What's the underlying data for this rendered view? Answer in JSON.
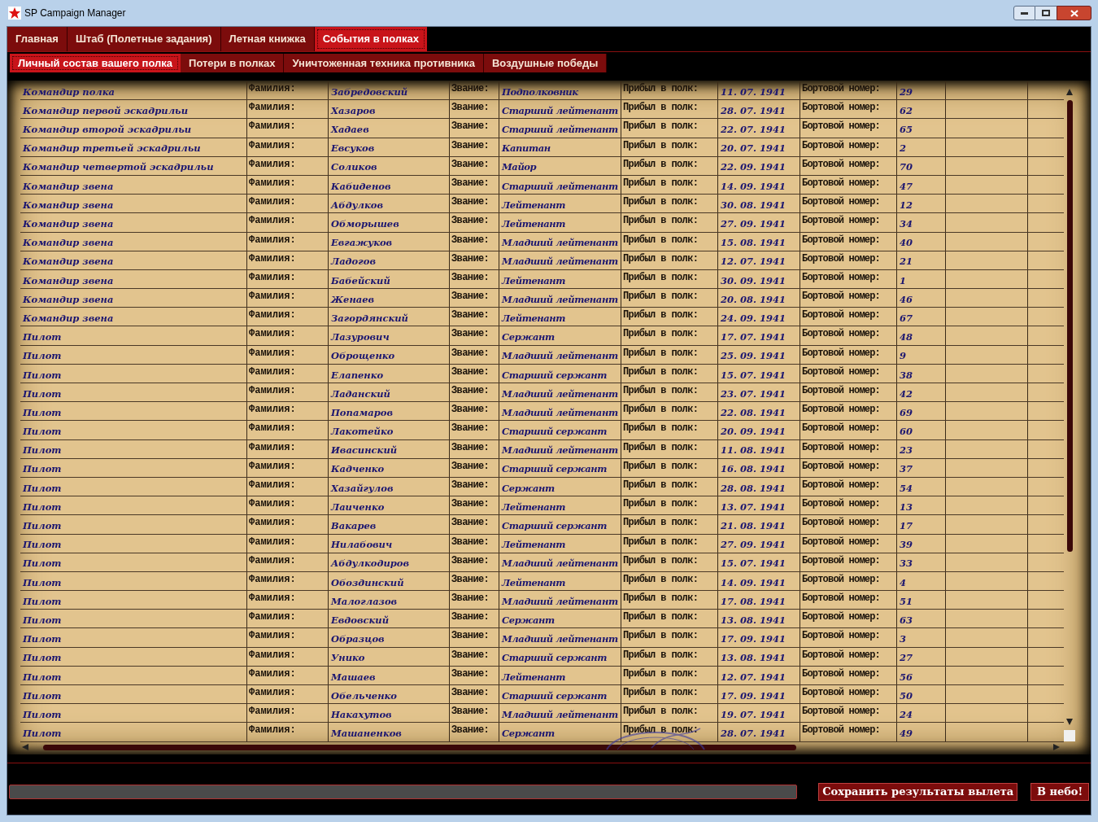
{
  "window": {
    "title": "SP Campaign Manager"
  },
  "tabs": [
    {
      "label": "Главная",
      "selected": false
    },
    {
      "label": "Штаб (Полетные задания)",
      "selected": false
    },
    {
      "label": "Летная книжка",
      "selected": false
    },
    {
      "label": "События в полках",
      "selected": true
    }
  ],
  "subtabs": [
    {
      "label": "Личный состав вашего полка",
      "selected": true
    },
    {
      "label": "Потери в полках",
      "selected": false
    },
    {
      "label": "Уничтоженная техника противника",
      "selected": false
    },
    {
      "label": "Воздушные победы",
      "selected": false
    }
  ],
  "rows": [
    {
      "role": "Командир полка",
      "surname_label": "Фамилия:",
      "surname": "Забредовский",
      "rank_label": "Звание:",
      "rank": "Подполковник",
      "arrived_label": "Прибыл в полк:",
      "arrived": "11. 07. 1941",
      "number_label": "Бортовой номер:",
      "number": "29"
    },
    {
      "role": "Командир первой эскадрильи",
      "surname_label": "Фамилия:",
      "surname": "Хазаров",
      "rank_label": "Звание:",
      "rank": "Старший лейтенант",
      "arrived_label": "Прибыл в полк:",
      "arrived": "28. 07. 1941",
      "number_label": "Бортовой номер:",
      "number": "62"
    },
    {
      "role": "Командир второй эскадрильи",
      "surname_label": "Фамилия:",
      "surname": "Хадаев",
      "rank_label": "Звание:",
      "rank": "Старший лейтенант",
      "arrived_label": "Прибыл в полк:",
      "arrived": "22. 07. 1941",
      "number_label": "Бортовой номер:",
      "number": "65"
    },
    {
      "role": "Командир третьей эскадрильи",
      "surname_label": "Фамилия:",
      "surname": "Евсуков",
      "rank_label": "Звание:",
      "rank": "Капитан",
      "arrived_label": "Прибыл в полк:",
      "arrived": "20. 07. 1941",
      "number_label": "Бортовой номер:",
      "number": "2"
    },
    {
      "role": "Командир четвертой эскадрильи",
      "surname_label": "Фамилия:",
      "surname": "Соликов",
      "rank_label": "Звание:",
      "rank": "Майор",
      "arrived_label": "Прибыл в полк:",
      "arrived": "22. 09. 1941",
      "number_label": "Бортовой номер:",
      "number": "70"
    },
    {
      "role": "Командир звена",
      "surname_label": "Фамилия:",
      "surname": "Кабиденов",
      "rank_label": "Звание:",
      "rank": "Старший лейтенант",
      "arrived_label": "Прибыл в полк:",
      "arrived": "14. 09. 1941",
      "number_label": "Бортовой номер:",
      "number": "47"
    },
    {
      "role": "Командир звена",
      "surname_label": "Фамилия:",
      "surname": "Абдулков",
      "rank_label": "Звание:",
      "rank": "Лейтенант",
      "arrived_label": "Прибыл в полк:",
      "arrived": "30. 08. 1941",
      "number_label": "Бортовой номер:",
      "number": "12"
    },
    {
      "role": "Командир звена",
      "surname_label": "Фамилия:",
      "surname": "Обморышев",
      "rank_label": "Звание:",
      "rank": "Лейтенант",
      "arrived_label": "Прибыл в полк:",
      "arrived": "27. 09. 1941",
      "number_label": "Бортовой номер:",
      "number": "34"
    },
    {
      "role": "Командир звена",
      "surname_label": "Фамилия:",
      "surname": "Евгажуков",
      "rank_label": "Звание:",
      "rank": "Младший лейтенант",
      "arrived_label": "Прибыл в полк:",
      "arrived": "15. 08. 1941",
      "number_label": "Бортовой номер:",
      "number": "40"
    },
    {
      "role": "Командир звена",
      "surname_label": "Фамилия:",
      "surname": "Ладогов",
      "rank_label": "Звание:",
      "rank": "Младший лейтенант",
      "arrived_label": "Прибыл в полк:",
      "arrived": "12. 07. 1941",
      "number_label": "Бортовой номер:",
      "number": "21"
    },
    {
      "role": "Командир звена",
      "surname_label": "Фамилия:",
      "surname": "Бабейский",
      "rank_label": "Звание:",
      "rank": "Лейтенант",
      "arrived_label": "Прибыл в полк:",
      "arrived": "30. 09. 1941",
      "number_label": "Бортовой номер:",
      "number": "1"
    },
    {
      "role": "Командир звена",
      "surname_label": "Фамилия:",
      "surname": "Женаев",
      "rank_label": "Звание:",
      "rank": "Младший лейтенант",
      "arrived_label": "Прибыл в полк:",
      "arrived": "20. 08. 1941",
      "number_label": "Бортовой номер:",
      "number": "46"
    },
    {
      "role": "Командир звена",
      "surname_label": "Фамилия:",
      "surname": "Загордянский",
      "rank_label": "Звание:",
      "rank": "Лейтенант",
      "arrived_label": "Прибыл в полк:",
      "arrived": "24. 09. 1941",
      "number_label": "Бортовой номер:",
      "number": "67"
    },
    {
      "role": "Пилот",
      "surname_label": "Фамилия:",
      "surname": "Лазурович",
      "rank_label": "Звание:",
      "rank": "Сержант",
      "arrived_label": "Прибыл в полк:",
      "arrived": "17. 07. 1941",
      "number_label": "Бортовой номер:",
      "number": "48"
    },
    {
      "role": "Пилот",
      "surname_label": "Фамилия:",
      "surname": "Оброщенко",
      "rank_label": "Звание:",
      "rank": "Младший лейтенант",
      "arrived_label": "Прибыл в полк:",
      "arrived": "25. 09. 1941",
      "number_label": "Бортовой номер:",
      "number": "9"
    },
    {
      "role": "Пилот",
      "surname_label": "Фамилия:",
      "surname": "Елапенко",
      "rank_label": "Звание:",
      "rank": "Старший сержант",
      "arrived_label": "Прибыл в полк:",
      "arrived": "15. 07. 1941",
      "number_label": "Бортовой номер:",
      "number": "38"
    },
    {
      "role": "Пилот",
      "surname_label": "Фамилия:",
      "surname": "Ладанский",
      "rank_label": "Звание:",
      "rank": "Младший лейтенант",
      "arrived_label": "Прибыл в полк:",
      "arrived": "23. 07. 1941",
      "number_label": "Бортовой номер:",
      "number": "42"
    },
    {
      "role": "Пилот",
      "surname_label": "Фамилия:",
      "surname": "Попамаров",
      "rank_label": "Звание:",
      "rank": "Младший лейтенант",
      "arrived_label": "Прибыл в полк:",
      "arrived": "22. 08. 1941",
      "number_label": "Бортовой номер:",
      "number": "69"
    },
    {
      "role": "Пилот",
      "surname_label": "Фамилия:",
      "surname": "Лакотейко",
      "rank_label": "Звание:",
      "rank": "Старший сержант",
      "arrived_label": "Прибыл в полк:",
      "arrived": "20. 09. 1941",
      "number_label": "Бортовой номер:",
      "number": "60"
    },
    {
      "role": "Пилот",
      "surname_label": "Фамилия:",
      "surname": "Ивасинский",
      "rank_label": "Звание:",
      "rank": "Младший лейтенант",
      "arrived_label": "Прибыл в полк:",
      "arrived": "11. 08. 1941",
      "number_label": "Бортовой номер:",
      "number": "23"
    },
    {
      "role": "Пилот",
      "surname_label": "Фамилия:",
      "surname": "Кадченко",
      "rank_label": "Звание:",
      "rank": "Старший сержант",
      "arrived_label": "Прибыл в полк:",
      "arrived": "16. 08. 1941",
      "number_label": "Бортовой номер:",
      "number": "37"
    },
    {
      "role": "Пилот",
      "surname_label": "Фамилия:",
      "surname": "Хазайгулов",
      "rank_label": "Звание:",
      "rank": "Сержант",
      "arrived_label": "Прибыл в полк:",
      "arrived": "28. 08. 1941",
      "number_label": "Бортовой номер:",
      "number": "54"
    },
    {
      "role": "Пилот",
      "surname_label": "Фамилия:",
      "surname": "Лаиченко",
      "rank_label": "Звание:",
      "rank": "Лейтенант",
      "arrived_label": "Прибыл в полк:",
      "arrived": "13. 07. 1941",
      "number_label": "Бортовой номер:",
      "number": "13"
    },
    {
      "role": "Пилот",
      "surname_label": "Фамилия:",
      "surname": "Вакарев",
      "rank_label": "Звание:",
      "rank": "Старший сержант",
      "arrived_label": "Прибыл в полк:",
      "arrived": "21. 08. 1941",
      "number_label": "Бортовой номер:",
      "number": "17"
    },
    {
      "role": "Пилот",
      "surname_label": "Фамилия:",
      "surname": "Нилабович",
      "rank_label": "Звание:",
      "rank": "Лейтенант",
      "arrived_label": "Прибыл в полк:",
      "arrived": "27. 09. 1941",
      "number_label": "Бортовой номер:",
      "number": "39"
    },
    {
      "role": "Пилот",
      "surname_label": "Фамилия:",
      "surname": "Абдулкодиров",
      "rank_label": "Звание:",
      "rank": "Младший лейтенант",
      "arrived_label": "Прибыл в полк:",
      "arrived": "15. 07. 1941",
      "number_label": "Бортовой номер:",
      "number": "33"
    },
    {
      "role": "Пилот",
      "surname_label": "Фамилия:",
      "surname": "Обоздинский",
      "rank_label": "Звание:",
      "rank": "Лейтенант",
      "arrived_label": "Прибыл в полк:",
      "arrived": "14. 09. 1941",
      "number_label": "Бортовой номер:",
      "number": "4"
    },
    {
      "role": "Пилот",
      "surname_label": "Фамилия:",
      "surname": "Малоглазов",
      "rank_label": "Звание:",
      "rank": "Младший лейтенант",
      "arrived_label": "Прибыл в полк:",
      "arrived": "17. 08. 1941",
      "number_label": "Бортовой номер:",
      "number": "51"
    },
    {
      "role": "Пилот",
      "surname_label": "Фамилия:",
      "surname": "Евдовский",
      "rank_label": "Звание:",
      "rank": "Сержант",
      "arrived_label": "Прибыл в полк:",
      "arrived": "13. 08. 1941",
      "number_label": "Бортовой номер:",
      "number": "63"
    },
    {
      "role": "Пилот",
      "surname_label": "Фамилия:",
      "surname": "Образцов",
      "rank_label": "Звание:",
      "rank": "Младший лейтенант",
      "arrived_label": "Прибыл в полк:",
      "arrived": "17. 09. 1941",
      "number_label": "Бортовой номер:",
      "number": "3"
    },
    {
      "role": "Пилот",
      "surname_label": "Фамилия:",
      "surname": "Унико",
      "rank_label": "Звание:",
      "rank": "Старший сержант",
      "arrived_label": "Прибыл в полк:",
      "arrived": "13. 08. 1941",
      "number_label": "Бортовой номер:",
      "number": "27"
    },
    {
      "role": "Пилот",
      "surname_label": "Фамилия:",
      "surname": "Машаев",
      "rank_label": "Звание:",
      "rank": "Лейтенант",
      "arrived_label": "Прибыл в полк:",
      "arrived": "12. 07. 1941",
      "number_label": "Бортовой номер:",
      "number": "56"
    },
    {
      "role": "Пилот",
      "surname_label": "Фамилия:",
      "surname": "Обельченко",
      "rank_label": "Звание:",
      "rank": "Старший сержант",
      "arrived_label": "Прибыл в полк:",
      "arrived": "17. 09. 1941",
      "number_label": "Бортовой номер:",
      "number": "50"
    },
    {
      "role": "Пилот",
      "surname_label": "Фамилия:",
      "surname": "Накахутов",
      "rank_label": "Звание:",
      "rank": "Младший лейтенант",
      "arrived_label": "Прибыл в полк:",
      "arrived": "19. 07. 1941",
      "number_label": "Бортовой номер:",
      "number": "24"
    },
    {
      "role": "Пилот",
      "surname_label": "Фамилия:",
      "surname": "Машаненков",
      "rank_label": "Звание:",
      "rank": "Сержант",
      "arrived_label": "Прибыл в полк:",
      "arrived": "28. 07. 1941",
      "number_label": "Бортовой номер:",
      "number": "49"
    }
  ],
  "progress": {
    "level": 0
  },
  "buttons": [
    {
      "label": "Сохранить результаты вылета"
    },
    {
      "label": "В небо!"
    }
  ]
}
